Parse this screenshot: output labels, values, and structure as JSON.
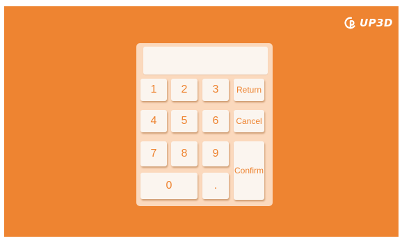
{
  "brand": {
    "logo_text": "UP3D",
    "icon": "up3d-logo-icon",
    "color": "#ffffff"
  },
  "colors": {
    "background": "#ee8431",
    "keypad_panel": "#fbd9bd",
    "key_face": "#fbf5ef",
    "key_text": "#ee8431"
  },
  "display": {
    "value": ""
  },
  "keys": {
    "one": "1",
    "two": "2",
    "three": "3",
    "four": "4",
    "five": "5",
    "six": "6",
    "seven": "7",
    "eight": "8",
    "nine": "9",
    "zero": "0",
    "dot": ".",
    "return": "Return",
    "cancel": "Cancel",
    "confirm": "Confirm"
  }
}
